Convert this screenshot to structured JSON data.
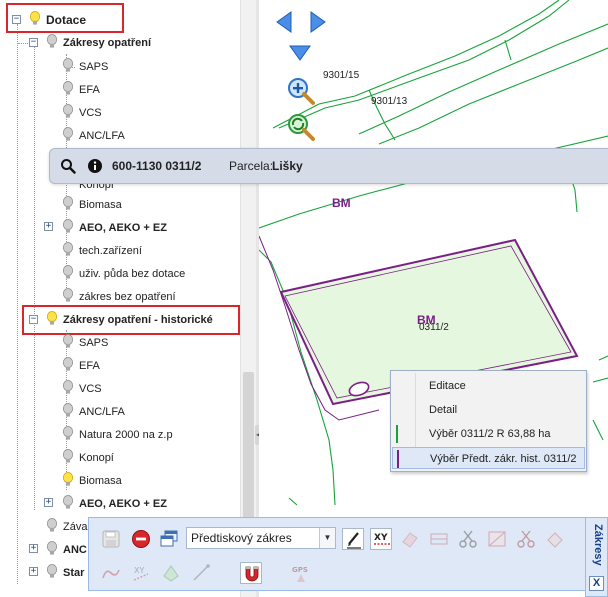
{
  "tree": {
    "root": {
      "label": "Dotace",
      "toggle": "−"
    },
    "group1": {
      "label": "Zákresy opatření",
      "toggle": "−",
      "items": [
        "SAPS",
        "EFA",
        "VCS",
        "ANC/LFA",
        "Konopí",
        "Biomasa"
      ]
    },
    "group1_sub": {
      "label": "AEO, AEKO + EZ",
      "toggle": "+"
    },
    "group1_tail": [
      "tech.zařízení",
      "uživ. půda bez dotace",
      "zákres bez opatření"
    ],
    "group2": {
      "label": "Zákresy opatření - historické",
      "toggle": "−",
      "items": [
        "SAPS",
        "EFA",
        "VCS",
        "ANC/LFA",
        "Natura 2000 na z.p",
        "Konopí",
        "Biomasa"
      ]
    },
    "group2_sub": {
      "label": "AEO, AEKO + EZ",
      "toggle": "+"
    },
    "trailing": [
      {
        "label": "Záva",
        "bold": false
      },
      {
        "label": "ANC",
        "bold": true
      },
      {
        "label": "Star",
        "bold": true
      }
    ]
  },
  "map": {
    "labels": [
      "9301/15",
      "9301/13",
      "0311/2"
    ],
    "bm_labels": [
      "BM",
      "BM"
    ]
  },
  "infobar": {
    "code": "600-1130 0311/2",
    "parcel_label": "Parcela:",
    "parcel_value": "Lišky"
  },
  "context_menu": {
    "items": [
      {
        "label": "Editace"
      },
      {
        "label": "Detail"
      },
      {
        "label": "Výběr 0311/2 R 63,88 ha"
      },
      {
        "label": "Výběr Předt. zákr. hist. 0311/2"
      }
    ]
  },
  "toolbar": {
    "combo_value": "Předtiskový zákres",
    "panel_title": "Zákresy",
    "close": "X"
  },
  "colors": {
    "highlight": "#d9262c",
    "parcel": "#7a1f86",
    "map_lines": "#18a33a",
    "parcel_fill": "#e6f7df"
  }
}
